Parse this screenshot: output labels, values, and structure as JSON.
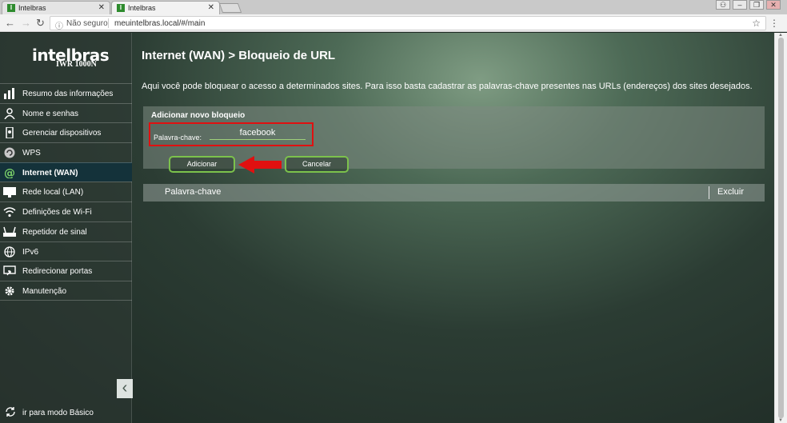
{
  "browser": {
    "tabs": [
      {
        "title": "Intelbras",
        "favicon": "I"
      },
      {
        "title": "Intelbras",
        "favicon": "I"
      }
    ],
    "security_label": "Não seguro",
    "url": "meuintelbras.local/#/main"
  },
  "sidebar": {
    "logo": "intelbras",
    "model": "IWR 1000N",
    "items": [
      {
        "label": "Resumo das informações",
        "icon": "bar-chart-icon"
      },
      {
        "label": "Nome e senhas",
        "icon": "user-icon"
      },
      {
        "label": "Gerenciar dispositivos",
        "icon": "device-icon"
      },
      {
        "label": "WPS",
        "icon": "wps-icon"
      },
      {
        "label": "Internet (WAN)",
        "icon": "at-sign-icon",
        "active": true
      },
      {
        "label": "Rede local (LAN)",
        "icon": "monitor-icon"
      },
      {
        "label": "Definições de Wi-Fi",
        "icon": "wifi-icon"
      },
      {
        "label": "Repetidor de sinal",
        "icon": "router-icon"
      },
      {
        "label": "IPv6",
        "icon": "globe-icon"
      },
      {
        "label": "Redirecionar portas",
        "icon": "port-forward-icon"
      },
      {
        "label": "Manutenção",
        "icon": "gear-icon"
      }
    ],
    "basic_mode_label": "ir para modo Básico"
  },
  "main": {
    "title": "Internet (WAN) > Bloqueio de URL",
    "description": "Aqui você pode bloquear o acesso a determinados sites. Para isso basta cadastrar as palavras-chave presentes nas URLs (endereços) dos sites desejados.",
    "panel": {
      "title": "Adicionar novo bloqueio",
      "keyword_label": "Palavra-chave:",
      "keyword_value": "facebook",
      "add_label": "Adicionar",
      "cancel_label": "Cancelar"
    },
    "table": {
      "col_keyword": "Palavra-chave",
      "col_delete": "Excluir"
    }
  },
  "colors": {
    "highlight_red": "#e01010",
    "button_border": "#7cc24c",
    "active_menu": "#14323a"
  }
}
